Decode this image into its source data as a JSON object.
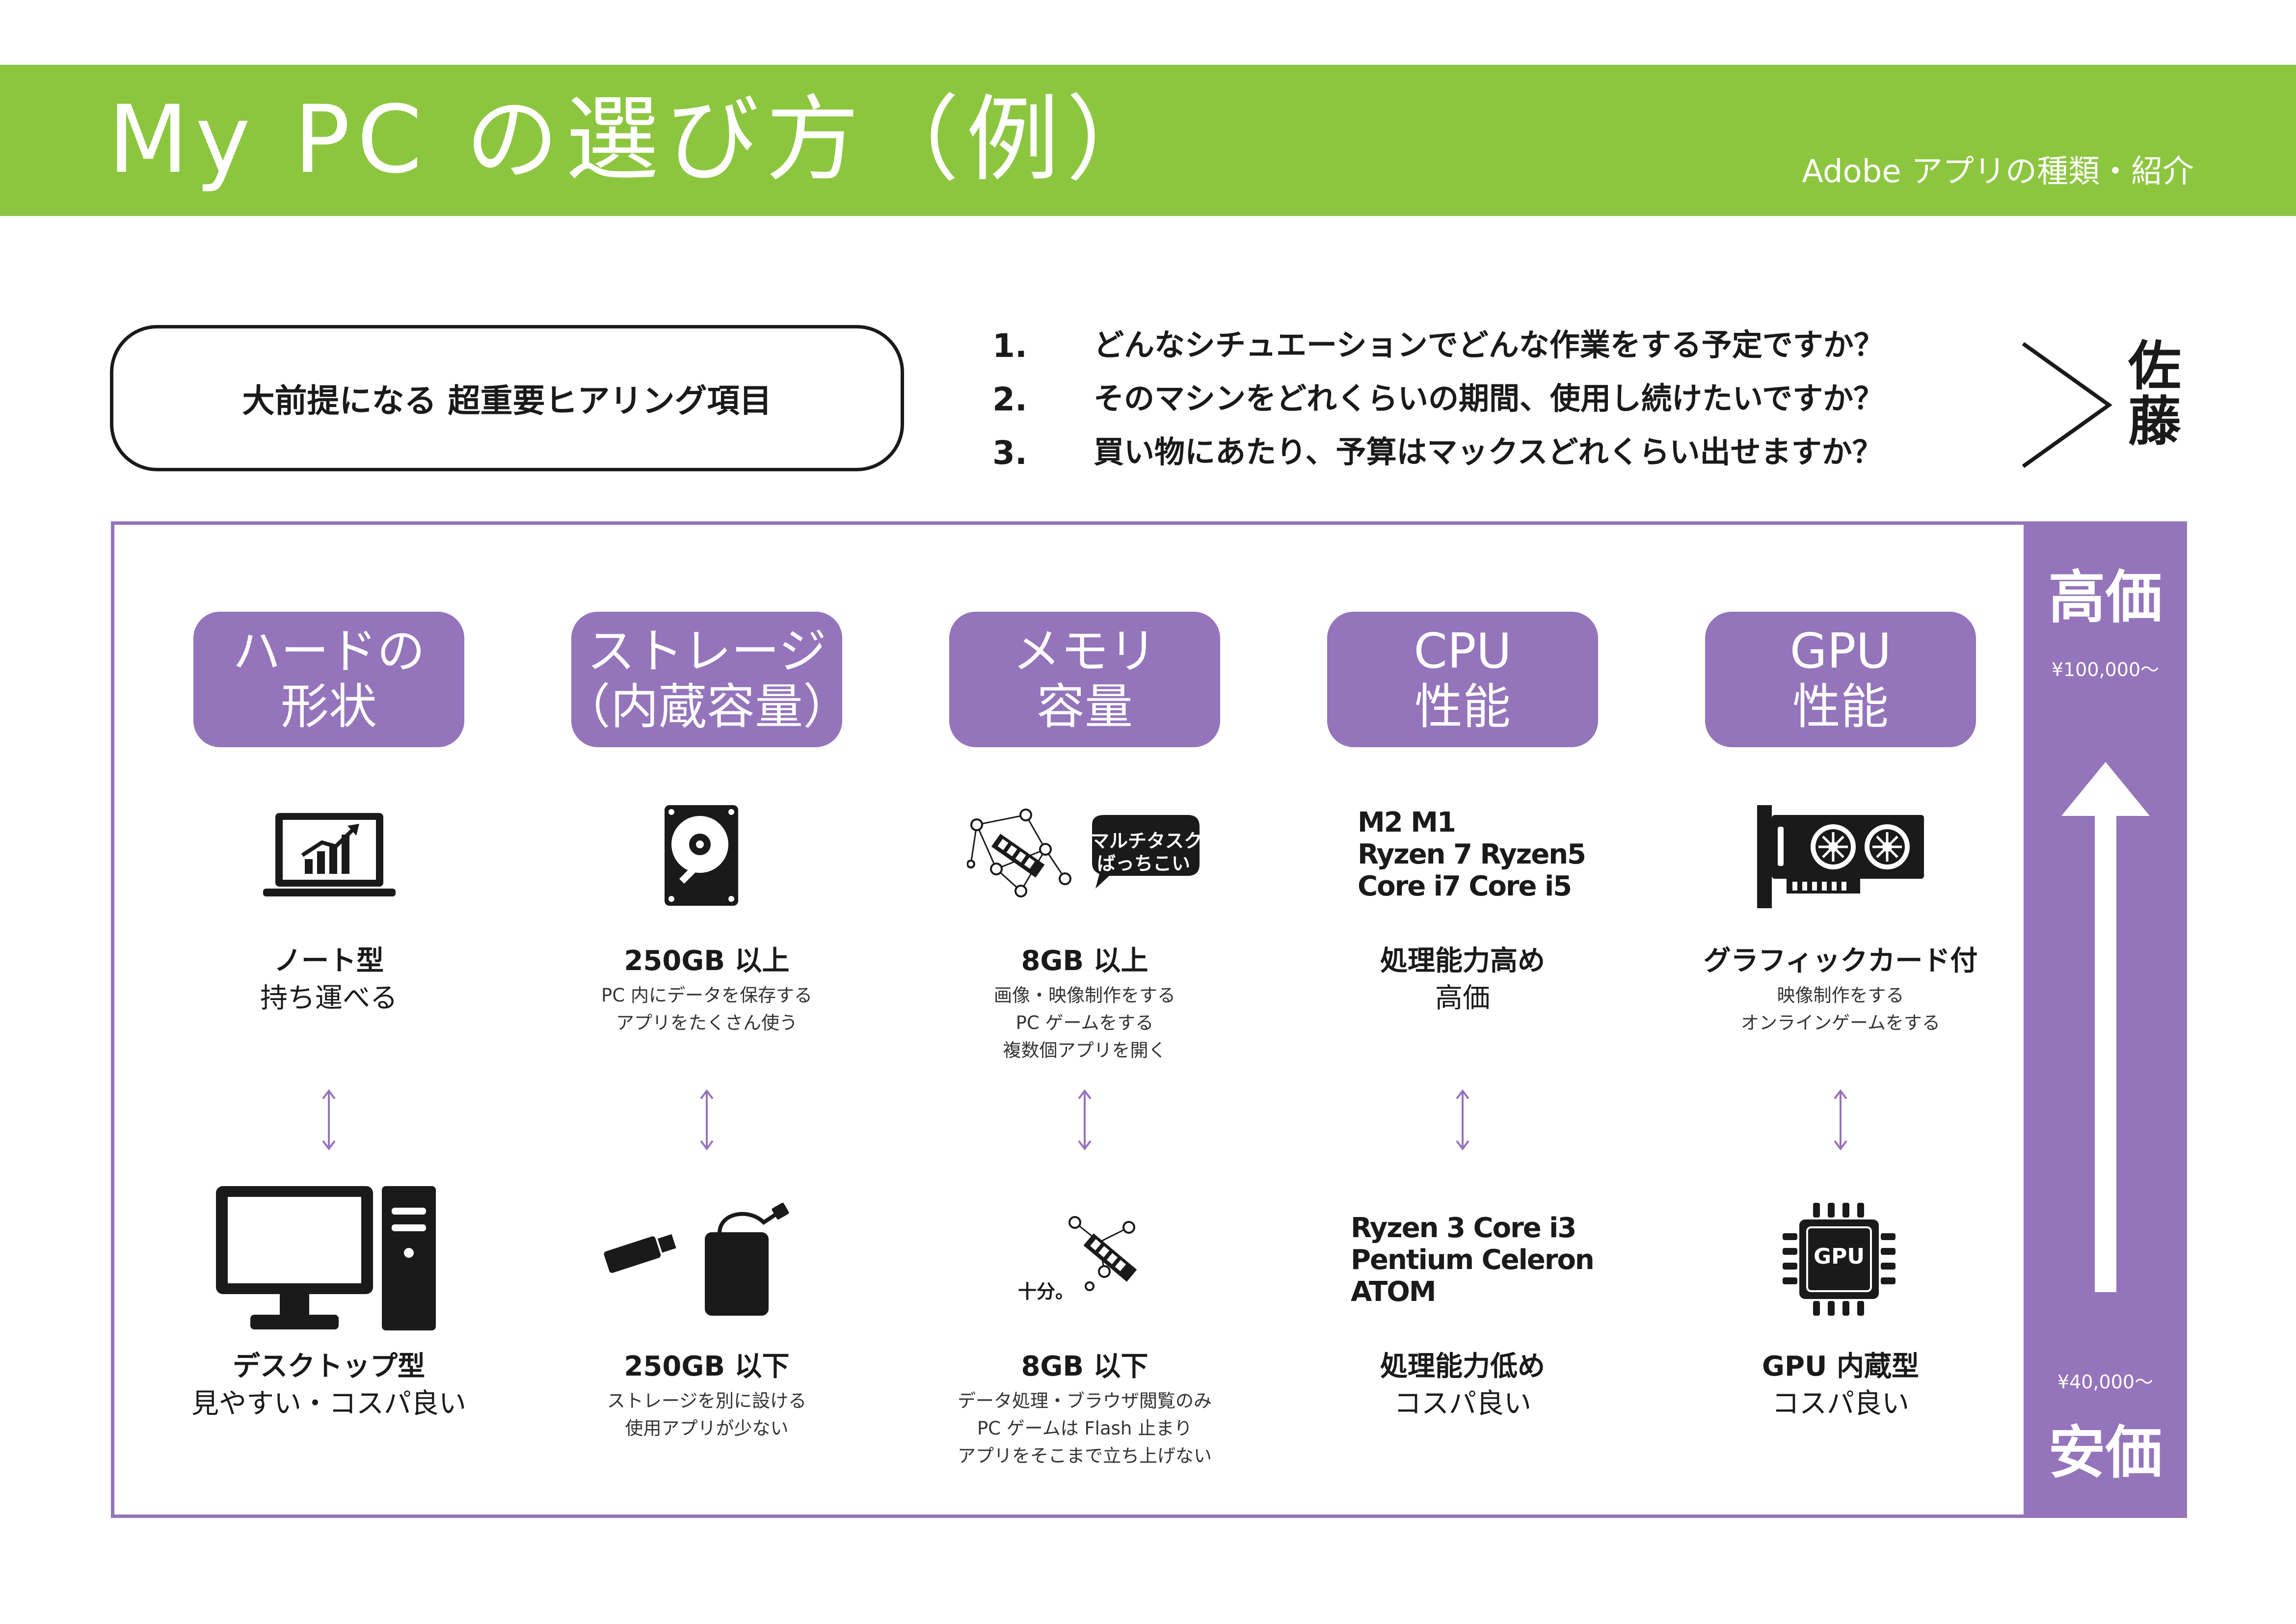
{
  "header": {
    "title": "My PC の選び方（例）",
    "subtitle": "Adobe アプリの種類・紹介",
    "color": "#8cc63f"
  },
  "premise": {
    "label": "大前提になる 超重要ヒアリング項目",
    "questions": [
      {
        "num": "1.",
        "text": "どんなシチュエーションでどんな作業をする予定ですか？"
      },
      {
        "num": "2.",
        "text": "そのマシンをどれくらいの期間、使用し続けたいですか？"
      },
      {
        "num": "3.",
        "text": "買い物にあたり、予算はマックスどれくらい出せますか？"
      }
    ],
    "person": "佐藤"
  },
  "price_scale": {
    "high_label": "高価",
    "high_value": "¥100,000～",
    "low_value": "¥40,000～",
    "low_label": "安価",
    "color": "#9474bb"
  },
  "columns": [
    {
      "header": [
        "ハードの",
        "形状"
      ],
      "top": {
        "icon": "laptop-chart-icon",
        "title": "ノート型",
        "sub": "持ち運べる",
        "notes": []
      },
      "bottom": {
        "icon": "desktop-computer-icon",
        "title": "デスクトップ型",
        "sub": "見やすい・コスパ良い",
        "notes": []
      }
    },
    {
      "header": [
        "ストレージ",
        "（内蔵容量）"
      ],
      "top": {
        "icon": "hard-disk-icon",
        "title": "250GB 以上",
        "sub": "",
        "notes": [
          "PC 内にデータを保存する",
          "アプリをたくさん使う"
        ]
      },
      "bottom": {
        "icon": "external-storage-icon",
        "title": "250GB 以下",
        "sub": "",
        "notes": [
          "ストレージを別に設ける",
          "使用アプリが少ない"
        ]
      }
    },
    {
      "header": [
        "メモリ",
        "容量"
      ],
      "top": {
        "icon": "memory-network-icon",
        "bubble": [
          "マルチタスク",
          "ばっちこい"
        ],
        "title": "8GB 以上",
        "sub": "",
        "notes": [
          "画像・映像制作をする",
          "PC ゲームをする",
          "複数個アプリを開く"
        ]
      },
      "bottom": {
        "icon": "memory-module-icon",
        "caption": "十分。",
        "title": "8GB 以下",
        "sub": "",
        "notes": [
          "データ処理・ブラウザ閲覧のみ",
          "PC ゲームは Flash 止まり",
          "アプリをそこまで立ち上げない"
        ]
      }
    },
    {
      "header": [
        "CPU",
        "性能"
      ],
      "top": {
        "icon_text": [
          "M2 M1",
          "Ryzen 7 Ryzen5",
          "Core i7 Core i5"
        ],
        "title": "処理能力高め",
        "sub": "高価",
        "notes": []
      },
      "bottom": {
        "icon_text": [
          "Ryzen 3 Core i3",
          "Pentium Celeron",
          "ATOM"
        ],
        "title": "処理能力低め",
        "sub": "コスパ良い",
        "notes": []
      }
    },
    {
      "header": [
        "GPU",
        "性能"
      ],
      "top": {
        "icon": "graphics-card-icon",
        "title": "グラフィックカード付",
        "sub": "",
        "notes": [
          "映像制作をする",
          "オンラインゲームをする"
        ]
      },
      "bottom": {
        "icon": "gpu-chip-icon",
        "chip_label": "GPU",
        "title": "GPU 内蔵型",
        "sub": "コスパ良い",
        "notes": []
      }
    }
  ]
}
